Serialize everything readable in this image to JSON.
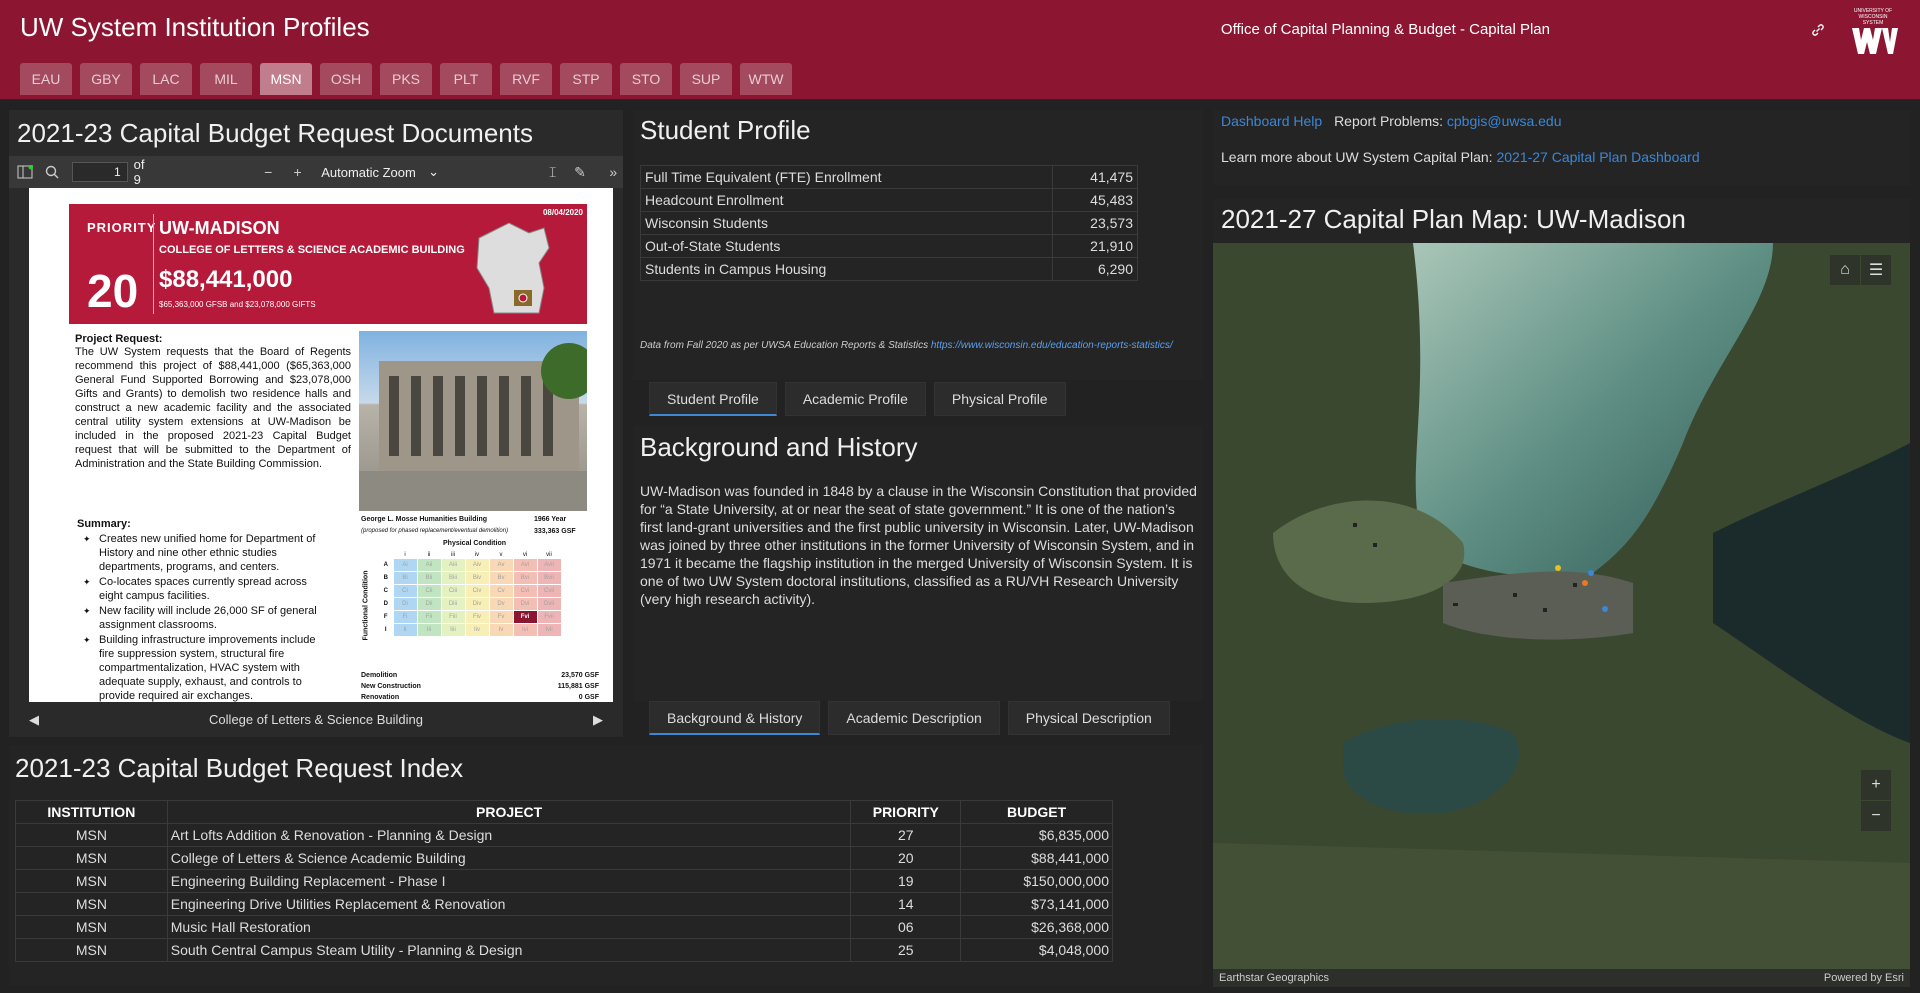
{
  "header": {
    "title": "UW System Institution Profiles",
    "office": "Office of Capital Planning & Budget - Capital Plan",
    "logo_text_1": "UNIVERSITY OF",
    "logo_text_2": "WISCONSIN SYSTEM",
    "institutions": [
      "EAU",
      "GBY",
      "LAC",
      "MIL",
      "MSN",
      "OSH",
      "PKS",
      "PLT",
      "RVF",
      "STP",
      "STO",
      "SUP",
      "WTW"
    ],
    "active_institution": "MSN"
  },
  "pdf": {
    "title": "2021-23 Capital Budget Request Documents",
    "page": "1",
    "page_of": "of 9",
    "zoom": "Automatic Zoom",
    "nav_label": "College of Letters & Science Building",
    "doc": {
      "priority_label": "PRIORITY",
      "priority": "20",
      "institution": "UW-MADISON",
      "project": "COLLEGE OF LETTERS & SCIENCE ACADEMIC BUILDING",
      "amount": "$88,441,000",
      "funding": "$65,363,000 GFSB and $23,078,000 GIFTS",
      "date": "08/04/2020",
      "request_heading": "Project Request:",
      "request_text": "The UW System requests that the Board of Regents recommend this project of $88,441,000 ($65,363,000 General Fund Supported Borrowing and $23,078,000 Gifts and Grants) to demolish two residence halls and construct a new academic facility and the associated central utility system extensions at UW-Madison be included in the proposed 2021-23 Capital Budget request that will be submitted to the Department of Administration and the State Building Commission.",
      "summary_heading": "Summary:",
      "summary": [
        "Creates new unified home for Department of History and nine other ethnic studies departments, programs, and centers.",
        "Co-locates spaces currently spread across eight campus facilities.",
        "New facility will include 26,000 SF of general assignment classrooms.",
        "Building infrastructure improvements include fire suppression system, structural fire compartmentalization, HVAC system with adequate supply, exhaust, and controls to provide required air exchanges."
      ],
      "building_name": "George L. Mosse Humanities Building",
      "building_year": "1966 Year",
      "building_note": "(proposed for phased replacement/eventual demolition)",
      "building_gsf": "333,363 GSF",
      "physical_condition": "Physical Condition",
      "functional_condition": "Functional Condition",
      "cols": [
        "i",
        "ii",
        "iii",
        "iv",
        "v",
        "vi",
        "vii"
      ],
      "rows": [
        "A",
        "B",
        "C",
        "D",
        "F",
        "I"
      ],
      "selected_cell": "Fvi",
      "stats": [
        {
          "label": "Demolition",
          "value": "23,570 GSF"
        },
        {
          "label": "New Construction",
          "value": "115,881 GSF"
        },
        {
          "label": "Renovation",
          "value": "0 GSF"
        }
      ]
    }
  },
  "student_profile": {
    "title": "Student Profile",
    "rows": [
      {
        "label": "Full Time Equivalent (FTE) Enrollment",
        "value": "41,475"
      },
      {
        "label": "Headcount Enrollment",
        "value": "45,483"
      },
      {
        "label": "Wisconsin Students",
        "value": "23,573"
      },
      {
        "label": "Out-of-State Students",
        "value": "21,910"
      },
      {
        "label": "Students in Campus Housing",
        "value": "6,290"
      }
    ],
    "footnote": "Data from Fall 2020 as per UWSA Education Reports & Statistics",
    "footnote_link": "https://www.wisconsin.edu/education-reports-statistics/",
    "tabs": [
      "Student Profile",
      "Academic Profile",
      "Physical Profile"
    ]
  },
  "background": {
    "title": "Background and History",
    "text": "UW-Madison was founded in 1848 by a clause in the Wisconsin Constitution that provided for “a State University, at or near the seat of state government.” It is one of the nation’s first land-grant universities and the first public university in Wisconsin. Later, UW-Madison was joined by three other institutions in the former University of Wisconsin System, and in 1971 it became the flagship institution in the merged University of Wisconsin System. It is one of two UW System doctoral institutions, classified as a RU/VH Research University (very high research activity).",
    "tabs": [
      "Background & History",
      "Academic Description",
      "Physical Description"
    ]
  },
  "index": {
    "title": "2021-23 Capital Budget Request Index",
    "headers": [
      "INSTITUTION",
      "PROJECT",
      "PRIORITY",
      "BUDGET"
    ],
    "rows": [
      [
        "MSN",
        "Art Lofts Addition & Renovation - Planning & Design",
        "27",
        "$6,835,000"
      ],
      [
        "MSN",
        "College of Letters & Science Academic Building",
        "20",
        "$88,441,000"
      ],
      [
        "MSN",
        "Engineering Building Replacement - Phase I",
        "19",
        "$150,000,000"
      ],
      [
        "MSN",
        "Engineering Drive Utilities Replacement & Renovation",
        "14",
        "$73,141,000"
      ],
      [
        "MSN",
        "Music Hall Restoration",
        "06",
        "$26,368,000"
      ],
      [
        "MSN",
        "South Central Campus Steam Utility - Planning & Design",
        "25",
        "$4,048,000"
      ]
    ]
  },
  "help": {
    "dashboard_help": "Dashboard Help",
    "report_label": "Report Problems:",
    "report_email": "cpbgis@uwsa.edu",
    "learn_label": "Learn more about UW System Capital Plan:",
    "learn_link": "2021-27 Capital Plan Dashboard"
  },
  "map": {
    "title": "2021-27 Capital Plan Map: UW-Madison",
    "attribution": "Earthstar Geographics",
    "powered": "Powered by Esri"
  }
}
